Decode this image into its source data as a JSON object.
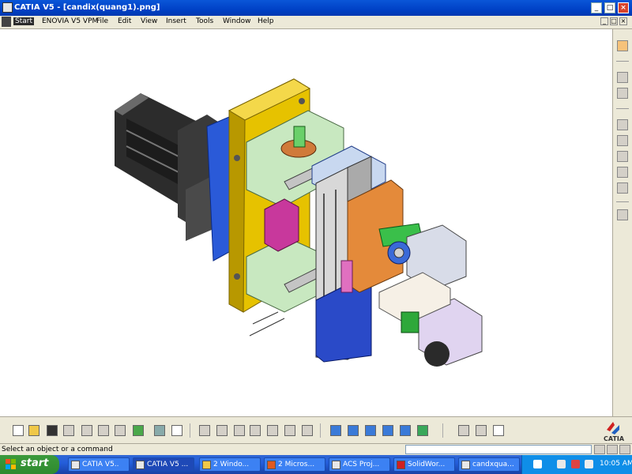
{
  "window": {
    "title": "CATIA V5 - [candix(quang1).png]",
    "min_label": "_",
    "max_label": "□",
    "close_label": "×"
  },
  "menu": {
    "items": [
      "Start",
      "ENOVIA V5 VPM",
      "File",
      "Edit",
      "View",
      "Insert",
      "Tools",
      "Window",
      "Help"
    ]
  },
  "mdi": {
    "min_label": "_",
    "restore_label": "□",
    "close_label": "×"
  },
  "right_toolbar": {
    "icons": [
      "select-arrow-icon",
      "view-icon",
      "zoom-icon",
      "catalog-icon",
      "sketch-icon",
      "table-icon",
      "table-edit-icon",
      "measure-icon",
      "lock-icon"
    ]
  },
  "bottom_toolbar": {
    "icons": [
      "new-icon",
      "open-icon",
      "save-icon",
      "print-icon",
      "cut-icon",
      "copy-icon",
      "paste-icon",
      "undo-icon",
      "redo-icon",
      "whats-this-icon",
      "formula-icon",
      "macro-icon",
      "compass-icon",
      "table-icon",
      "grid-icon",
      "hand-icon",
      "lock-icon",
      "fit-all-icon",
      "pan-icon",
      "rotate-icon",
      "zoom-in-icon",
      "zoom-out-icon",
      "normal-view-icon",
      "iso-view-icon",
      "first-page-icon",
      "previous-page-icon",
      "search-icon"
    ]
  },
  "catia_logo_text": "CATIA",
  "status": {
    "text": "Select an object or a command",
    "command_value": ""
  },
  "taskbar": {
    "start_label": "start",
    "tasks": [
      "CATIA V5..",
      "CATIA V5 ...",
      "2 Windo...",
      "2 Micros...",
      "ACS Proj...",
      "SolidWor...",
      "candxqua..."
    ],
    "clock": "10:05 AM"
  },
  "colors": {
    "title_blue": "#0a56d8",
    "taskbar_blue": "#245edb",
    "start_green": "#3c9a3c",
    "chrome": "#ece9d8"
  }
}
